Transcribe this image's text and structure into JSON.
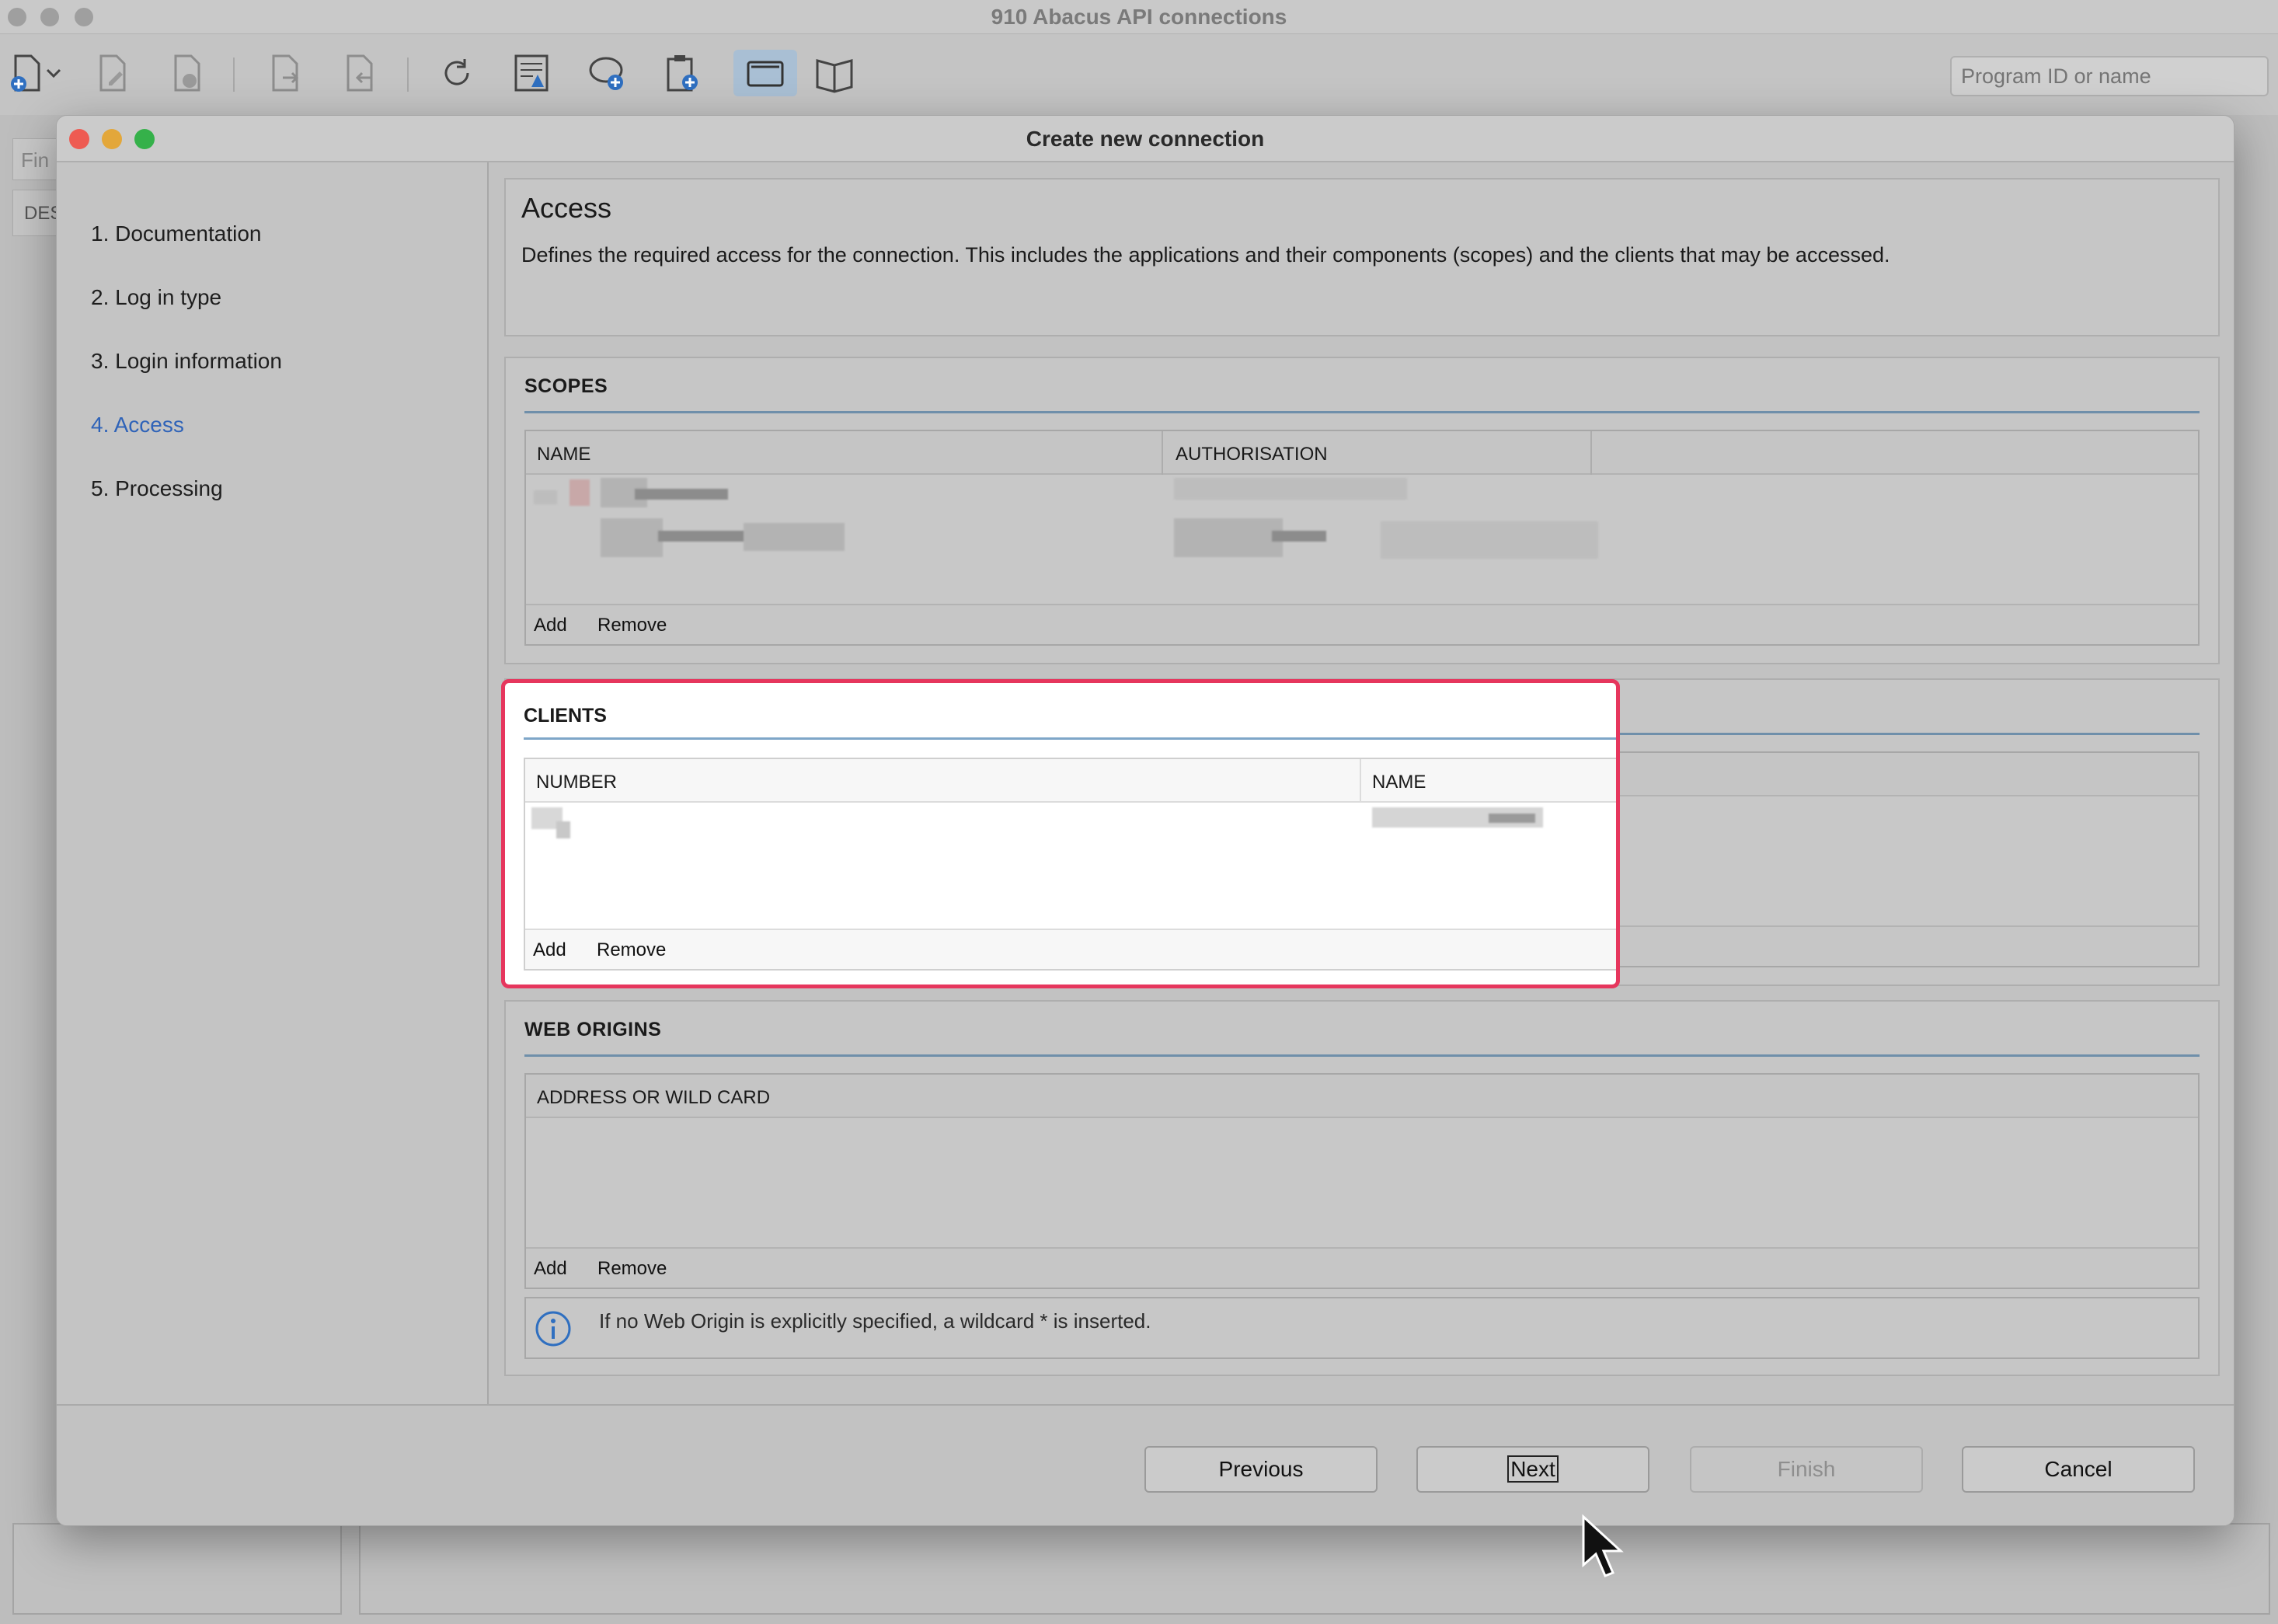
{
  "app": {
    "title": "910 Abacus API connections",
    "search_placeholder": "Program ID or name",
    "bg_find": "Fin",
    "bg_des": "DES"
  },
  "toolbar_icons": [
    "new-document-icon",
    "dropdown-chevron-icon",
    "edit-document-icon",
    "delete-document-icon",
    "export-icon",
    "import-icon",
    "refresh-icon",
    "report-icon",
    "comment-add-icon",
    "clipboard-add-icon",
    "window-icon",
    "book-icon"
  ],
  "dialog": {
    "title": "Create new connection",
    "steps": [
      {
        "label": "1. Documentation",
        "active": false
      },
      {
        "label": "2. Log in type",
        "active": false
      },
      {
        "label": "3. Login information",
        "active": false
      },
      {
        "label": "4. Access",
        "active": true
      },
      {
        "label": "5. Processing",
        "active": false
      }
    ],
    "access": {
      "title": "Access",
      "description": "Defines the required access for the connection. This includes the applications and their components (scopes) and the clients that may be accessed."
    },
    "scopes": {
      "title": "SCOPES",
      "col_name": "NAME",
      "col_auth": "AUTHORISATION",
      "add": "Add",
      "remove": "Remove"
    },
    "clients": {
      "title": "CLIENTS",
      "col_number": "NUMBER",
      "col_name": "NAME",
      "add": "Add",
      "remove": "Remove"
    },
    "web_origins": {
      "title": "WEB ORIGINS",
      "col_address": "ADDRESS OR WILD CARD",
      "add": "Add",
      "remove": "Remove",
      "info": "If no Web Origin is explicitly specified, a wildcard * is inserted."
    },
    "buttons": {
      "previous": "Previous",
      "next": "Next",
      "finish": "Finish",
      "cancel": "Cancel"
    }
  },
  "colors": {
    "highlight": "#e6365d",
    "active_step": "#2f63b8",
    "close": "#ee5b52",
    "minimize": "#e3a73a",
    "zoom": "#35b14a"
  }
}
